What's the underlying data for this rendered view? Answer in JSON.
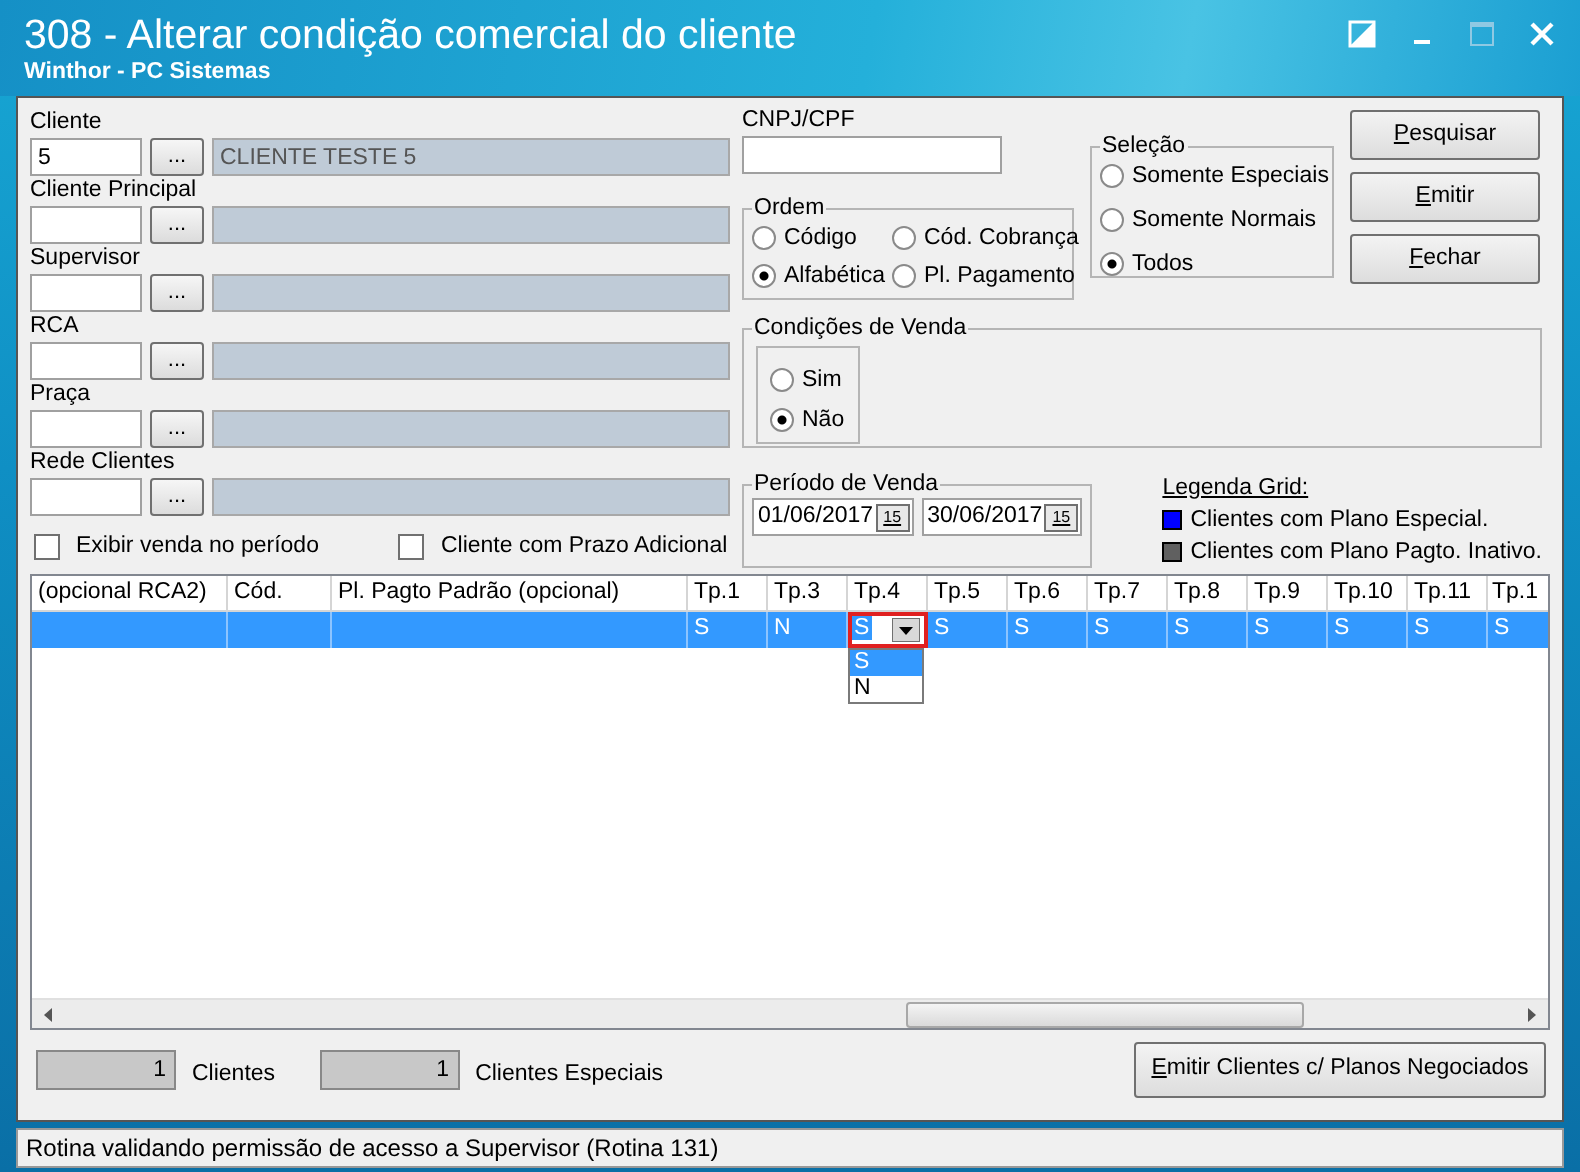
{
  "window": {
    "title": "308 - Alterar condição comercial do cliente",
    "subtitle": "Winthor - PC Sistemas"
  },
  "lookups": [
    {
      "label": "Cliente",
      "code": "5",
      "browse_label": "...",
      "name": "CLIENTE TESTE 5"
    },
    {
      "label": "Cliente Principal",
      "browse_label": "..."
    },
    {
      "label": "Supervisor",
      "browse_label": "..."
    },
    {
      "label": "RCA",
      "browse_label": "..."
    },
    {
      "label": "Praça",
      "browse_label": "..."
    },
    {
      "label": "Rede Clientes",
      "browse_label": "..."
    }
  ],
  "checkboxes": [
    {
      "label": "Exibir venda no período",
      "checked": false
    },
    {
      "label": "Cliente com Prazo Adicional",
      "checked": false
    }
  ],
  "cnpj": {
    "label": "CNPJ/CPF"
  },
  "ordem": {
    "title": "Ordem",
    "options": [
      {
        "label": "Código",
        "selected": false
      },
      {
        "label": "Cód. Cobrança",
        "selected": false
      },
      {
        "label": "Alfabética",
        "selected": true
      },
      {
        "label": "Pl. Pagamento",
        "selected": false
      }
    ]
  },
  "selecao": {
    "title": "Seleção",
    "options": [
      {
        "label": "Somente Especiais",
        "selected": false
      },
      {
        "label": "Somente Normais",
        "selected": false
      },
      {
        "label": "Todos",
        "selected": true
      }
    ]
  },
  "buttons": [
    {
      "label": "Pesquisar",
      "mnemonic": true
    },
    {
      "label": "Emitir",
      "mnemonic": true
    },
    {
      "label": "Fechar",
      "mnemonic": true
    }
  ],
  "condicoes": {
    "title": "Condições de Venda",
    "options": [
      {
        "label": "Sim",
        "selected": false
      },
      {
        "label": "Não",
        "selected": true
      }
    ]
  },
  "periodo": {
    "title": "Período de Venda",
    "dates": [
      {
        "value": "01/06/2017",
        "picker_label": "15"
      },
      {
        "value": "30/06/2017",
        "picker_label": "15"
      }
    ]
  },
  "legend": {
    "title": "Legenda Grid:",
    "items": [
      {
        "label": "Clientes com Plano Especial.",
        "color": "#0000ff"
      },
      {
        "label": "Clientes com Plano Pagto. Inativo.",
        "color": "#606060"
      }
    ]
  },
  "grid": {
    "columns": [
      {
        "label": "(opcional RCA2)",
        "kind": "text"
      },
      {
        "label": "Cód.",
        "kind": "text"
      },
      {
        "label": "Pl. Pagto Padrão (opcional)",
        "kind": "text"
      },
      {
        "label": "Tp.1",
        "kind": "flag"
      },
      {
        "label": "Tp.3",
        "kind": "flag"
      },
      {
        "label": "Tp.4",
        "kind": "flag"
      },
      {
        "label": "Tp.5",
        "kind": "flag"
      },
      {
        "label": "Tp.6",
        "kind": "flag"
      },
      {
        "label": "Tp.7",
        "kind": "flag"
      },
      {
        "label": "Tp.8",
        "kind": "flag"
      },
      {
        "label": "Tp.9",
        "kind": "flag"
      },
      {
        "label": "Tp.10",
        "kind": "flag"
      },
      {
        "label": "Tp.11",
        "kind": "flag"
      },
      {
        "label": "Tp.1",
        "kind": "flag"
      }
    ],
    "rows": [
      {
        "selected": true,
        "flags": [
          {
            "value": "S",
            "editing": false
          },
          {
            "value": "N",
            "editing": false
          },
          {
            "value": "S",
            "editing": true,
            "options": [
              {
                "label": "S",
                "selected": true
              },
              {
                "label": "N",
                "selected": false
              }
            ]
          },
          {
            "value": "S",
            "editing": false
          },
          {
            "value": "S",
            "editing": false
          },
          {
            "value": "S",
            "editing": false
          },
          {
            "value": "S",
            "editing": false
          },
          {
            "value": "S",
            "editing": false
          },
          {
            "value": "S",
            "editing": false
          },
          {
            "value": "S",
            "editing": false
          },
          {
            "value": "S",
            "editing": false
          }
        ]
      }
    ]
  },
  "counters": [
    {
      "value": "1",
      "label": "Clientes"
    },
    {
      "value": "1",
      "label": "Clientes Especiais"
    }
  ],
  "report_button": {
    "label": "Emitir Clientes c/ Planos Negociados",
    "mnemonic": true
  },
  "status_bar": "Rotina validando permissão de acesso a Supervisor (Rotina 131)"
}
